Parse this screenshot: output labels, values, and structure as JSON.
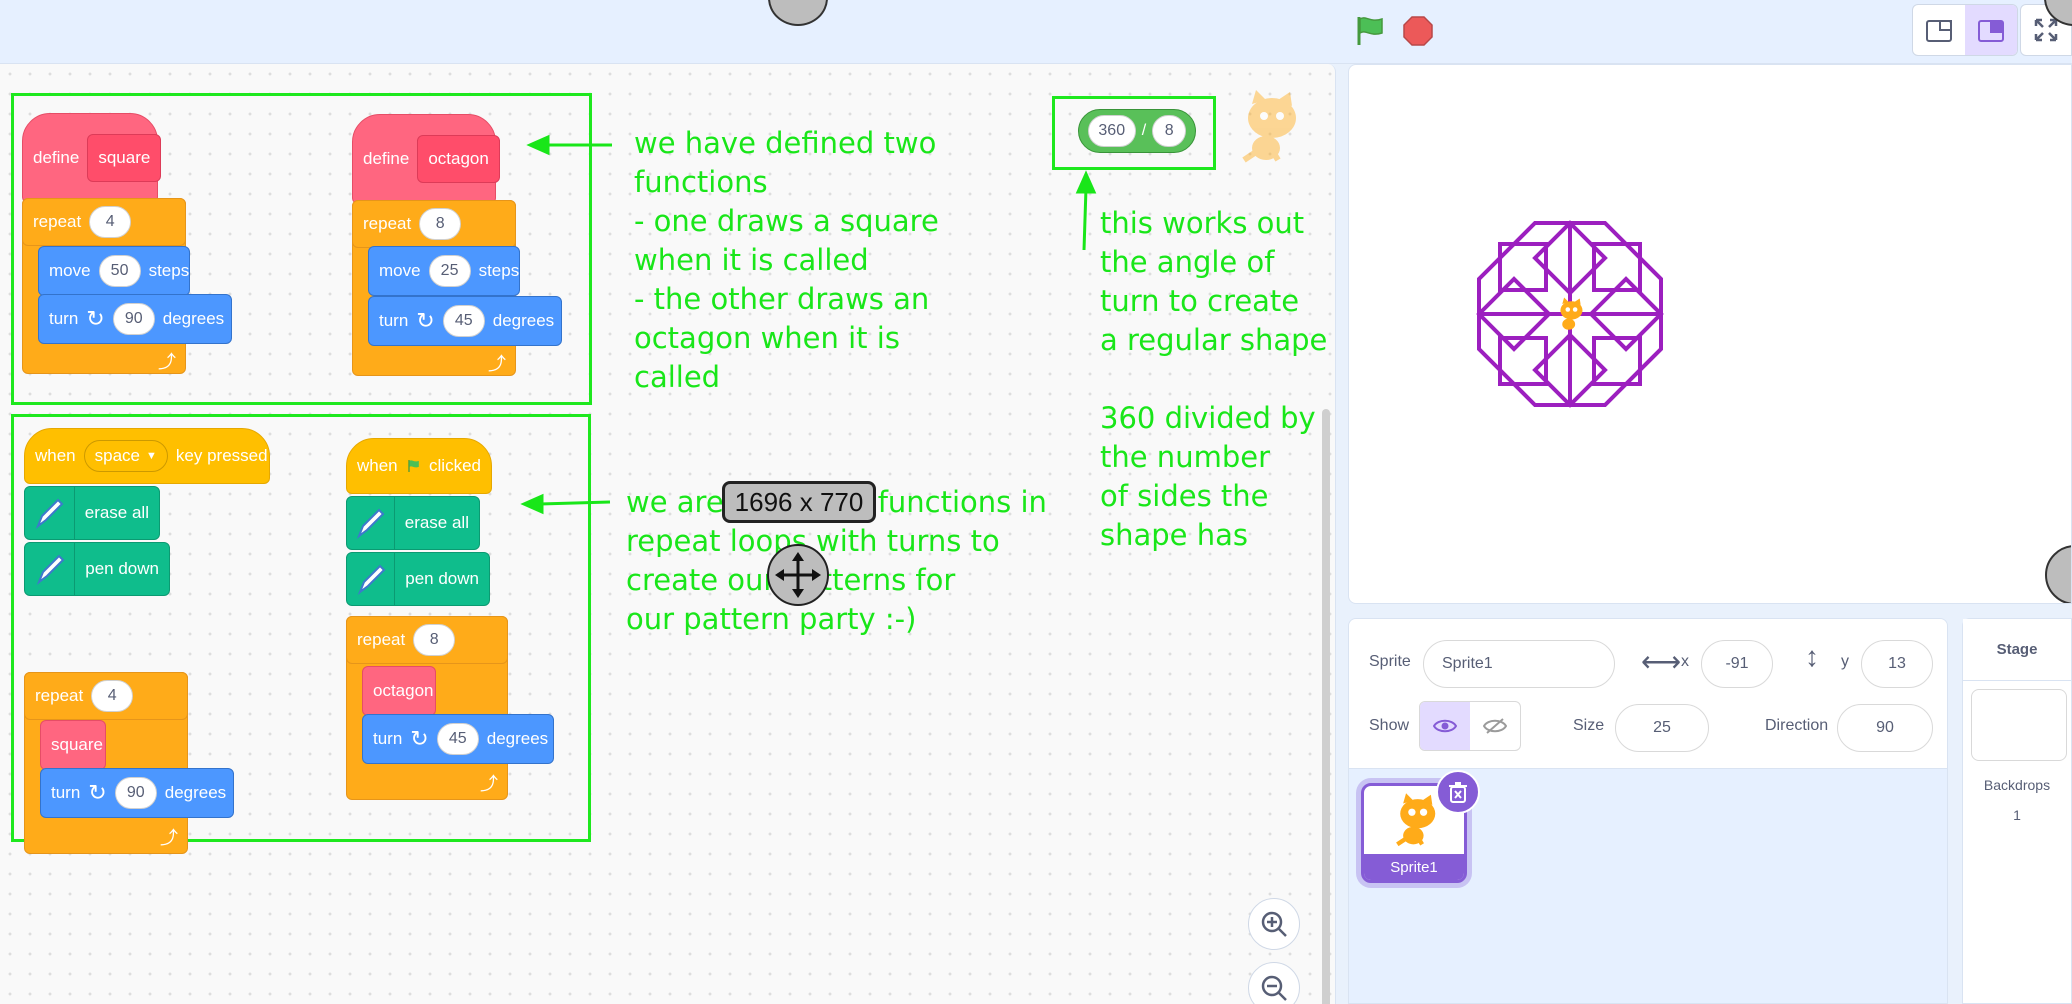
{
  "toolbar": {
    "flag_icon": "green-flag-icon",
    "stop_icon": "stop-icon",
    "layout_small_icon": "small-stage-icon",
    "layout_normal_icon": "normal-stage-icon",
    "fullscreen_icon": "fullscreen-icon"
  },
  "colors": {
    "annotation_green": "#19e619",
    "define_pink": "#ff6680",
    "control_orange": "#ffab19",
    "motion_blue": "#4c97ff",
    "pen_teal": "#0fbd8c",
    "event_yellow": "#ffbf00",
    "pen_purple": "#9c1fbf"
  },
  "scripts": {
    "define_square": {
      "define": "define",
      "name": "square",
      "repeat": "repeat",
      "repeat_count": "4",
      "move": "move",
      "move_steps": "50",
      "steps": "steps",
      "turn": "turn",
      "turn_degrees": "90",
      "degrees": "degrees"
    },
    "define_octagon": {
      "define": "define",
      "name": "octagon",
      "repeat": "repeat",
      "repeat_count": "8",
      "move": "move",
      "move_steps": "25",
      "steps": "steps",
      "turn": "turn",
      "turn_degrees": "45",
      "degrees": "degrees"
    },
    "space_script": {
      "when": "when",
      "key": "space",
      "key_pressed": "key pressed",
      "erase_all": "erase all",
      "pen_down": "pen down",
      "repeat": "repeat",
      "repeat_count": "4",
      "call": "square",
      "turn": "turn",
      "turn_degrees": "90",
      "degrees": "degrees"
    },
    "flag_script": {
      "when": "when",
      "clicked": "clicked",
      "erase_all": "erase all",
      "pen_down": "pen down",
      "repeat": "repeat",
      "repeat_count": "8",
      "call": "octagon",
      "turn": "turn",
      "turn_degrees": "45",
      "degrees": "degrees"
    },
    "divide": {
      "left": "360",
      "op": "/",
      "right": "8"
    }
  },
  "notes": {
    "functions": "we have defined two\nfunctions\n- one draws a square\nwhen it is called\n- the other draws an\noctagon when it is\ncalled",
    "loops": "we are using our functions in\nrepeat loops with turns to\ncreate our patterns for\nour pattern party :-)",
    "angle": "this works out\nthe angle of\nturn to create\na regular shape\n\n360 divided by\nthe number\nof sides the\nshape has"
  },
  "overlay": {
    "dimensions": "1696 x 770"
  },
  "sprite_info": {
    "sprite_label": "Sprite",
    "sprite_name": "Sprite1",
    "x_label": "x",
    "x_value": "-91",
    "y_label": "y",
    "y_value": "13",
    "show_label": "Show",
    "size_label": "Size",
    "size_value": "25",
    "direction_label": "Direction",
    "direction_value": "90"
  },
  "sprite_list": [
    {
      "name": "Sprite1",
      "selected": true
    }
  ],
  "stage_panel": {
    "title": "Stage",
    "backdrops_label": "Backdrops",
    "backdrops_count": "1"
  }
}
